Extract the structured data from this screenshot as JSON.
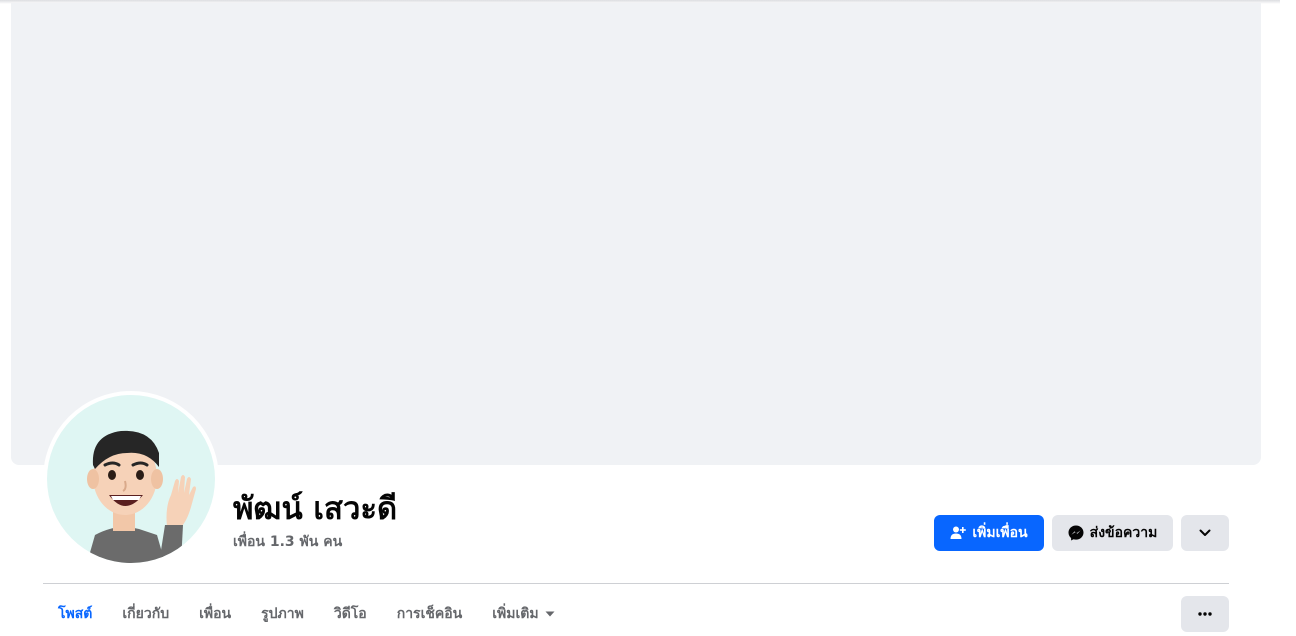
{
  "profile": {
    "name": "พัฒน์ เสวะดี",
    "friends_count": "เพื่อน 1.3 พัน คน",
    "avatar_icon": "avatar-cartoon-waving"
  },
  "actions": {
    "add_friend_label": "เพิ่มเพื่อน",
    "add_friend_icon": "add-friend-icon",
    "message_label": "ส่งข้อความ",
    "message_icon": "messenger-icon",
    "more_icon": "chevron-down-icon"
  },
  "tabs": [
    {
      "label": "โพสต์",
      "active": true
    },
    {
      "label": "เกี่ยวกับ",
      "active": false
    },
    {
      "label": "เพื่อน",
      "active": false
    },
    {
      "label": "รูปภาพ",
      "active": false
    },
    {
      "label": "วิดีโอ",
      "active": false
    },
    {
      "label": "การเช็คอิน",
      "active": false
    },
    {
      "label": "เพิ่มเติม",
      "active": false
    }
  ],
  "colors": {
    "accent": "#0866ff",
    "cover_bg": "#f0f2f5",
    "secondary_button": "#e4e6eb",
    "muted_text": "#65676b"
  }
}
